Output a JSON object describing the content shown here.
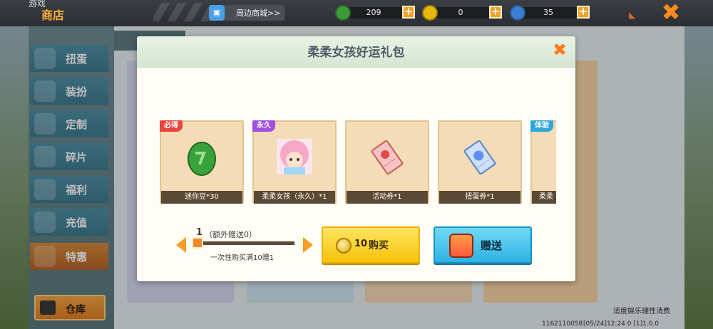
{
  "topbar": {
    "subtitle": "游戏",
    "title": "商店",
    "mall_label": "周边商城>>",
    "currencies": [
      {
        "name": "mini-bean",
        "value": "209",
        "color": "#3e9b3a"
      },
      {
        "name": "mini-coin",
        "value": "0",
        "color": "#e6b90f"
      },
      {
        "name": "star",
        "value": "35",
        "color": "#3b7fd1"
      }
    ],
    "rss_icon": "rss",
    "close_glyph": "✖"
  },
  "sidebar": {
    "items": [
      {
        "label": "扭蛋",
        "icon": "capsule-icon"
      },
      {
        "label": "装扮",
        "icon": "outfit-icon"
      },
      {
        "label": "定制",
        "icon": "pencil-icon"
      },
      {
        "label": "碎片",
        "icon": "puzzle-icon"
      },
      {
        "label": "福利",
        "icon": "gift-icon"
      },
      {
        "label": "充值",
        "icon": "coins-icon"
      },
      {
        "label": "特惠",
        "icon": "box-icon",
        "active": true
      }
    ],
    "warehouse_label": "仓库"
  },
  "footer": {
    "uid": "1162110058",
    "meta": "[05/24]12:24 0 [1]1.0.0",
    "notice": "适度娱乐理性消费"
  },
  "dialog": {
    "title": "柔柔女孩好运礼包",
    "close_glyph": "✖",
    "items": [
      {
        "tag": "必得",
        "tag_color": "#e8453f",
        "name": "迷你豆*30",
        "icon": "green-bean-icon"
      },
      {
        "tag": "永久",
        "tag_color": "#a14fe0",
        "name": "柔柔女孩（永久）*1",
        "icon": "girl-avatar-icon"
      },
      {
        "tag": "",
        "tag_color": "",
        "name": "活动券*1",
        "icon": "event-ticket-icon"
      },
      {
        "tag": "",
        "tag_color": "",
        "name": "扭蛋券*1",
        "icon": "capsule-ticket-icon"
      },
      {
        "tag": "体验",
        "tag_color": "#2fa7d8",
        "name": "柔柔",
        "icon": "partial-item-icon"
      }
    ],
    "quantity": "1",
    "extra_gift": "（额外赠送0）",
    "promo_rule": "一次性购买满10赠1",
    "buy_price": "10",
    "buy_label": "购买",
    "gift_label": "赠送"
  }
}
